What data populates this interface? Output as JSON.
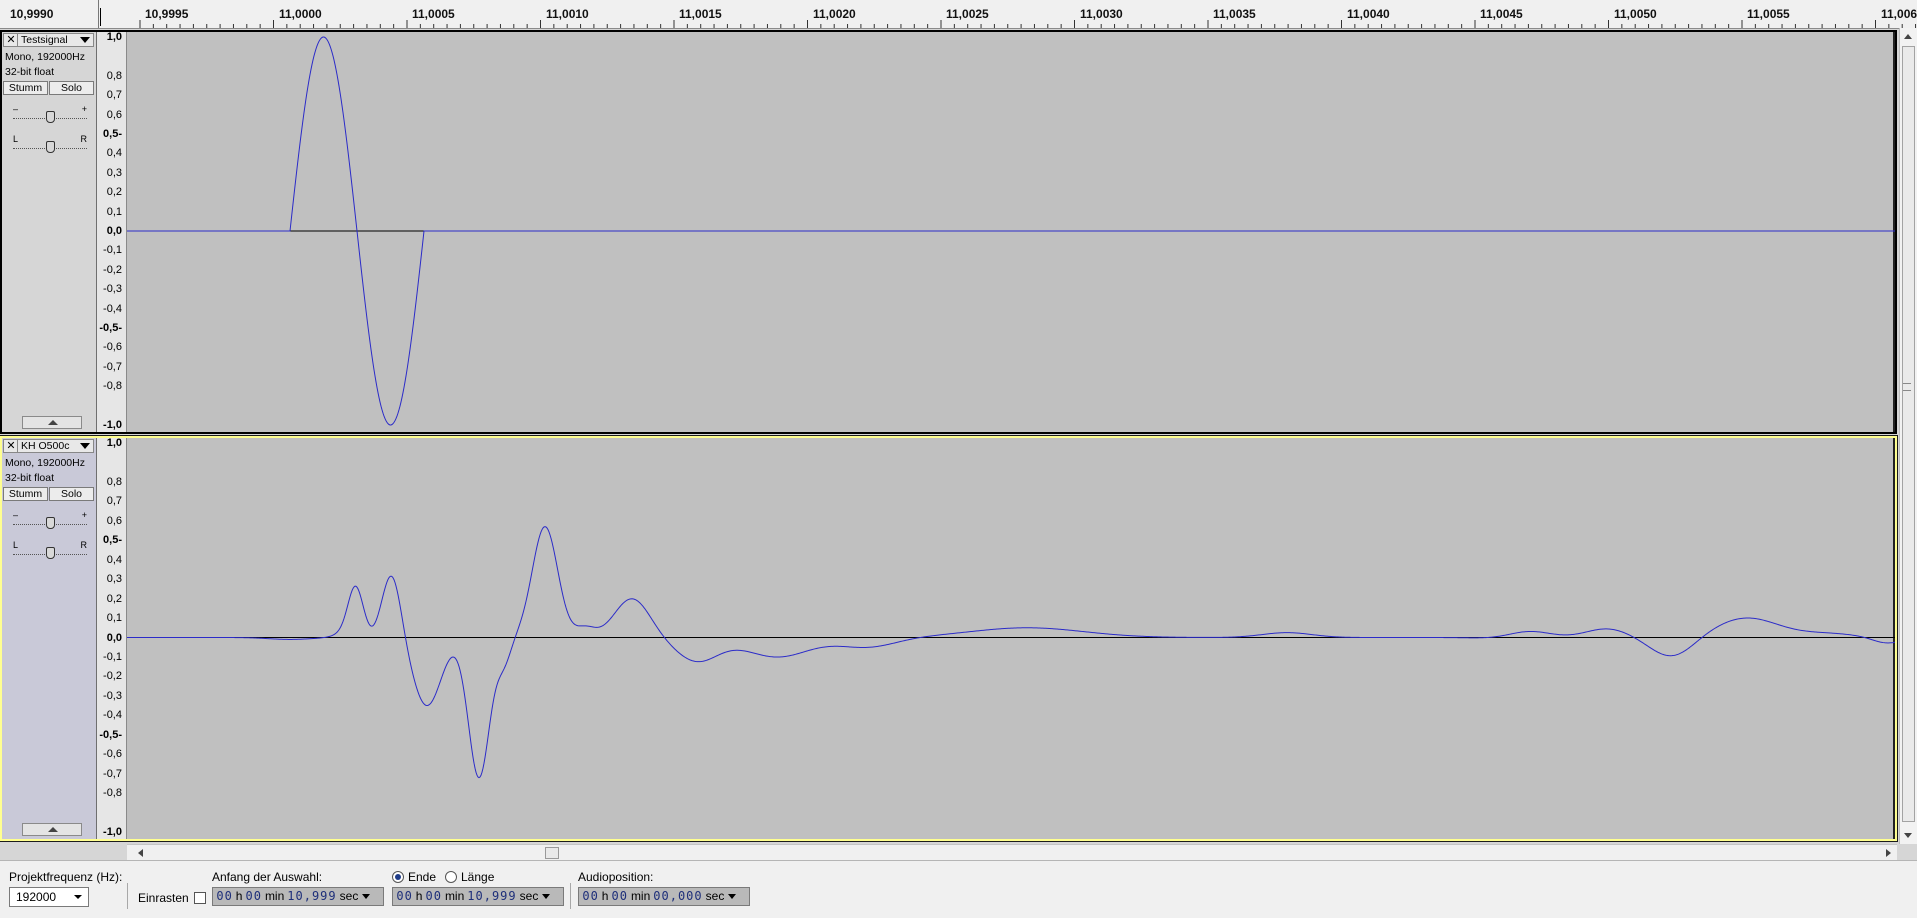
{
  "ruler": {
    "labels": [
      "10,9990",
      "10,9995",
      "11,0000",
      "11,0005",
      "11,0010",
      "11,0015",
      "11,0020",
      "11,0025",
      "11,0030",
      "11,0035",
      "11,0040",
      "11,0045",
      "11,0050",
      "11,0055",
      "11,006"
    ]
  },
  "tracks": [
    {
      "name": "Testsignal",
      "info1": "Mono, 192000Hz",
      "info2": "32-bit float",
      "mute_label": "Stumm",
      "solo_label": "Solo",
      "gain_minus": "–",
      "gain_plus": "+",
      "pan_left": "L",
      "pan_right": "R",
      "vruler": [
        "1,0",
        "0,8",
        "0,7",
        "0,6",
        "0,5-",
        "0,4",
        "0,3",
        "0,2",
        "0,1",
        "0,0",
        "-0,1",
        "-0,2",
        "-0,3",
        "-0,4",
        "-0,5-",
        "-0,6",
        "-0,7",
        "-0,8",
        "-1,0"
      ]
    },
    {
      "name": "KH O500c",
      "info1": "Mono, 192000Hz",
      "info2": "32-bit float",
      "mute_label": "Stumm",
      "solo_label": "Solo",
      "gain_minus": "–",
      "gain_plus": "+",
      "pan_left": "L",
      "pan_right": "R",
      "vruler": [
        "1,0",
        "0,8",
        "0,7",
        "0,6",
        "0,5-",
        "0,4",
        "0,3",
        "0,2",
        "0,1",
        "0,0",
        "-0,1",
        "-0,2",
        "-0,3",
        "-0,4",
        "-0,5-",
        "-0,6",
        "-0,7",
        "-0,8",
        "-1,0"
      ]
    }
  ],
  "toolbar": {
    "projektfrequenz_label": "Projektfrequenz (Hz):",
    "projektfrequenz_value": "192000",
    "einrasten_label": "Einrasten",
    "anfang_label": "Anfang der Auswahl:",
    "ende_label": "Ende",
    "laenge_label": "Länge",
    "audioposition_label": "Audioposition:",
    "anfang_time": {
      "h": "00",
      "h_unit": "h",
      "m": "00",
      "m_unit": "min",
      "s": "10,999",
      "s_unit": "sec"
    },
    "ende_time": {
      "h": "00",
      "h_unit": "h",
      "m": "00",
      "m_unit": "min",
      "s": "10,999",
      "s_unit": "sec"
    },
    "audio_time": {
      "h": "00",
      "h_unit": "h",
      "m": "00",
      "m_unit": "min",
      "s": "00,000",
      "s_unit": "sec"
    }
  },
  "colors": {
    "waveform": "#2b2bc8",
    "waveform_bg": "#c0c0c0",
    "selected_border": "#ffff90"
  }
}
